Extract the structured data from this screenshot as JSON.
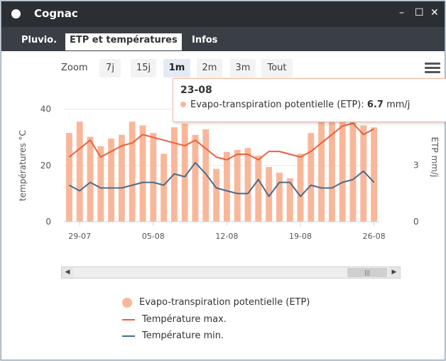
{
  "window": {
    "title": "Cognac",
    "controls": [
      "–",
      "☐",
      "✕"
    ]
  },
  "tabs": [
    {
      "label": "Pluvio.",
      "active": false
    },
    {
      "label": "ETP et températures",
      "active": true
    },
    {
      "label": "Infos",
      "active": false
    }
  ],
  "toolbar": {
    "zoom_label": "Zoom",
    "zoom_buttons": [
      {
        "label": "7j",
        "selected": false
      },
      {
        "label": "15j",
        "selected": false
      },
      {
        "label": "1m",
        "selected": true
      },
      {
        "label": "2m",
        "selected": false
      },
      {
        "label": "3m",
        "selected": false
      },
      {
        "label": "Tout",
        "selected": false
      }
    ]
  },
  "tooltip": {
    "date": "23-08",
    "series_label": "Evapo-transpiration potentielle (ETP):",
    "value": "6.7",
    "unit": "mm/j"
  },
  "legend": [
    {
      "label": "Evapo-transpiration potentielle (ETP)",
      "kind": "dot",
      "color": "#f9b79a"
    },
    {
      "label": "Température max.",
      "kind": "line",
      "color": "#e8613c"
    },
    {
      "label": "Température min.",
      "kind": "line",
      "color": "#4a6c8c"
    }
  ],
  "chart_data": {
    "type": "bar+line",
    "x_tick_labels": [
      "29-07",
      "05-08",
      "12-08",
      "19-08",
      "26-08"
    ],
    "y_left": {
      "label": "températures °C",
      "range": [
        0,
        47
      ],
      "ticks": [
        0,
        20,
        40
      ]
    },
    "y_right": {
      "label": "ETP mm/j",
      "range": [
        0,
        7
      ],
      "ticks": [
        0,
        3,
        6
      ]
    },
    "grid": true,
    "dates": [
      "28-07",
      "29-07",
      "30-07",
      "31-07",
      "01-08",
      "02-08",
      "03-08",
      "04-08",
      "05-08",
      "06-08",
      "07-08",
      "08-08",
      "09-08",
      "10-08",
      "11-08",
      "12-08",
      "13-08",
      "14-08",
      "15-08",
      "16-08",
      "17-08",
      "18-08",
      "19-08",
      "20-08",
      "21-08",
      "22-08",
      "23-08",
      "24-08",
      "25-08",
      "26-08"
    ],
    "series": [
      {
        "name": "Evapo-transpiration potentielle (ETP)",
        "type": "bar",
        "axis": "right",
        "color": "#f9b79a",
        "values": [
          4.7,
          5.3,
          4.5,
          4.0,
          4.4,
          4.6,
          5.3,
          5.1,
          4.7,
          3.6,
          5.0,
          5.2,
          4.6,
          4.9,
          2.8,
          3.7,
          3.8,
          3.9,
          3.5,
          2.9,
          2.6,
          2.3,
          3.6,
          4.7,
          5.3,
          6.0,
          6.7,
          6.0,
          5.1,
          5.0
        ]
      },
      {
        "name": "Température max.",
        "type": "line",
        "axis": "left",
        "color": "#e8613c",
        "values": [
          23,
          26,
          29,
          23,
          25,
          27,
          28,
          31,
          30,
          29,
          28,
          27,
          29,
          26,
          23,
          22,
          24,
          24,
          22,
          25,
          25,
          24,
          23,
          25,
          28,
          31,
          34,
          35,
          31,
          33
        ]
      },
      {
        "name": "Température min.",
        "type": "line",
        "axis": "left",
        "color": "#4a6c8c",
        "values": [
          13,
          11,
          14,
          12,
          12,
          12,
          13,
          14,
          14,
          13,
          17,
          16,
          21,
          17,
          12,
          11,
          10,
          10,
          15,
          9,
          14,
          14,
          9,
          13,
          12,
          12,
          14,
          15,
          18,
          14
        ]
      }
    ]
  }
}
